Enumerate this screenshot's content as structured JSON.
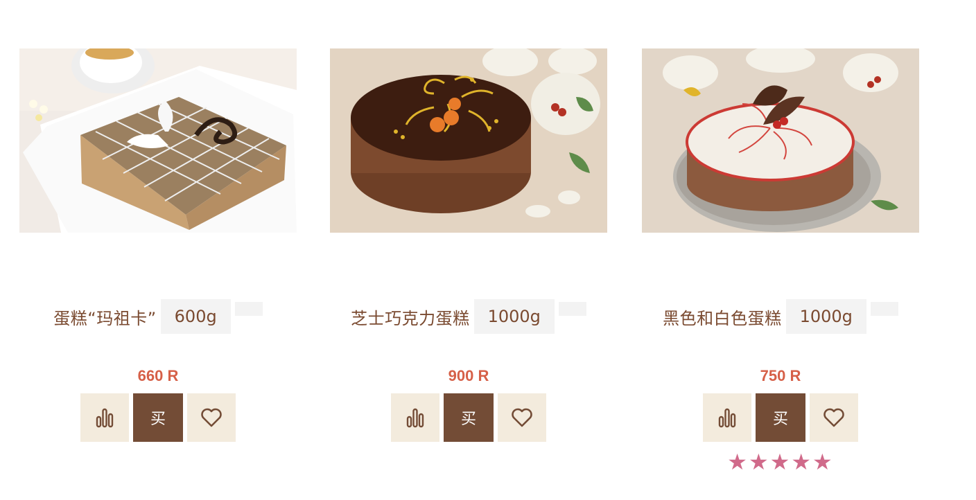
{
  "products": [
    {
      "name": "蛋糕“玛祖卡”",
      "weight": "600g",
      "price": "660 R",
      "buy_label": "买",
      "compare_icon": "chart-bars-icon",
      "wishlist_icon": "heart-icon",
      "rating_stars": 0,
      "image": "mazurka-cake"
    },
    {
      "name": "芝士巧克力蛋糕",
      "weight": "1000g",
      "price": "900 R",
      "buy_label": "买",
      "compare_icon": "chart-bars-icon",
      "wishlist_icon": "heart-icon",
      "rating_stars": 0,
      "image": "chocolate-cheese-cake"
    },
    {
      "name": "黑色和白色蛋糕",
      "weight": "1000g",
      "price": "750 R",
      "buy_label": "买",
      "compare_icon": "chart-bars-icon",
      "wishlist_icon": "heart-icon",
      "rating_stars": 5,
      "rating_text": "★★★★★",
      "image": "black-white-cake"
    }
  ],
  "colors": {
    "brand_brown": "#734c36",
    "text_brown": "#7a4a30",
    "price_red": "#d66048",
    "button_beige": "#f3ebdd",
    "star_pink": "#d06a8a"
  }
}
